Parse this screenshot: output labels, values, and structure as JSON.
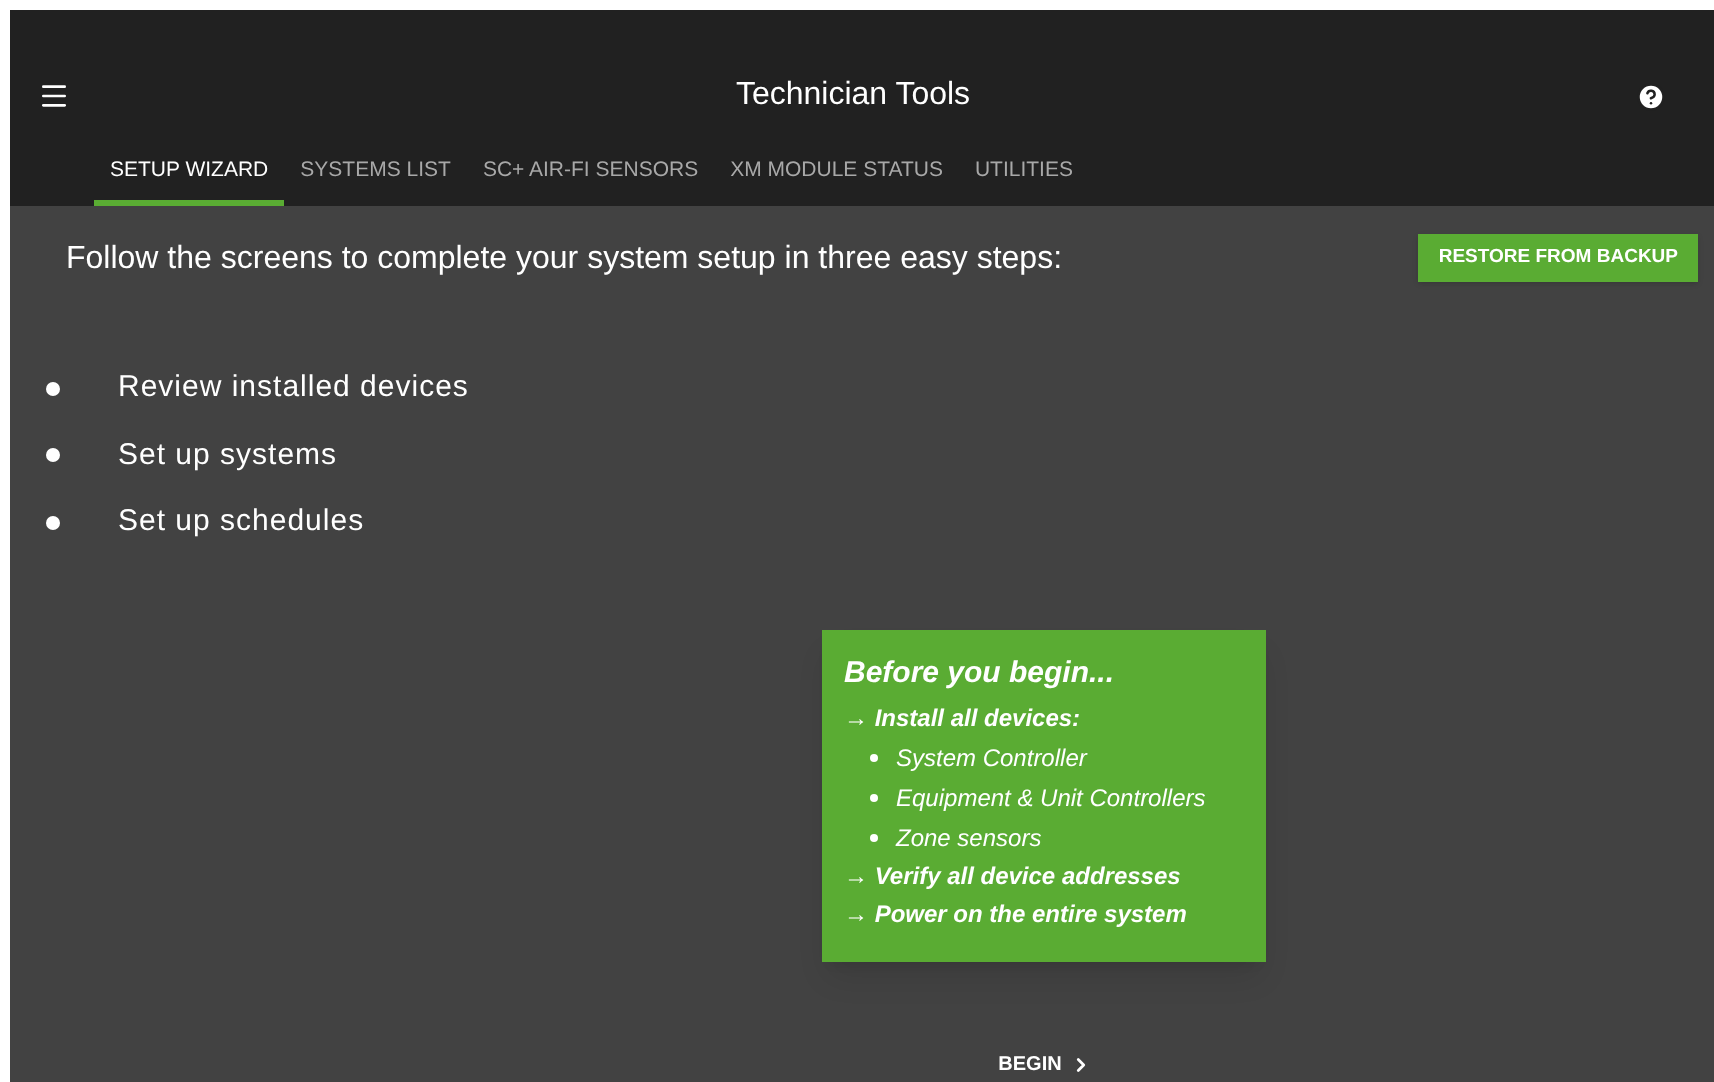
{
  "app_bar": {
    "title": "Technician Tools"
  },
  "tabs": [
    {
      "label": "SETUP WIZARD",
      "selected": true
    },
    {
      "label": "SYSTEMS LIST",
      "selected": false
    },
    {
      "label": "SC+ AIR-FI SENSORS",
      "selected": false
    },
    {
      "label": "XM MODULE STATUS",
      "selected": false
    },
    {
      "label": "UTILITIES",
      "selected": false
    }
  ],
  "intro": "Follow the screens to complete your system setup in three easy steps:",
  "restore_button": "RESTORE FROM BACKUP",
  "steps": [
    "Review installed devices",
    "Set up systems",
    "Set up schedules"
  ],
  "card": {
    "title": "Before you begin...",
    "items": [
      {
        "kind": "step",
        "text": "→ Install all devices:"
      },
      {
        "kind": "sub",
        "text": "System Controller"
      },
      {
        "kind": "sub",
        "text": "Equipment & Unit Controllers"
      },
      {
        "kind": "sub",
        "text": "Zone sensors"
      },
      {
        "kind": "step",
        "text": "→ Verify all device addresses"
      },
      {
        "kind": "step",
        "text": "→ Power on the entire system"
      }
    ]
  },
  "begin_button": "BEGIN"
}
